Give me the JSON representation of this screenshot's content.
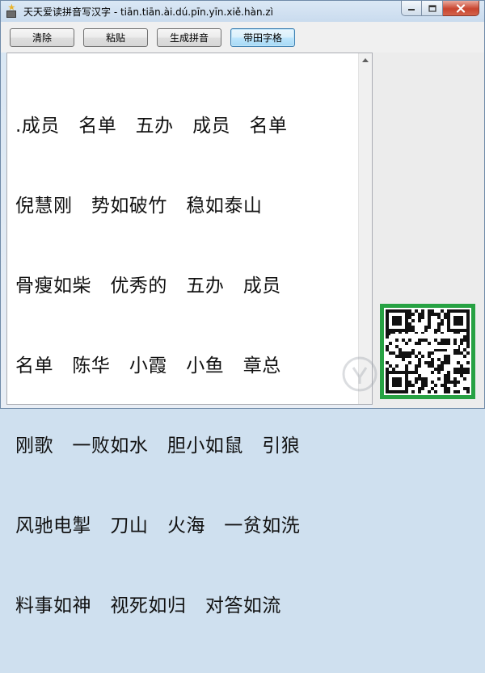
{
  "window": {
    "title": "天天爱读拼音写汉字 - tiān.tiān.ài.dú.pīn.yīn.xiě.hàn.zì"
  },
  "toolbar": {
    "buttons": [
      {
        "label": "清除"
      },
      {
        "label": "粘贴"
      },
      {
        "label": "生成拼音"
      },
      {
        "label": "带田字格"
      }
    ]
  },
  "editor": {
    "lines": [
      ".成员   名单   五办   成员   名单",
      "倪慧刚   势如破竹   稳如泰山",
      "骨瘦如柴   优秀的   五办   成员",
      "名单   陈华   小霞   小鱼   章总",
      "刚歌   一败如水   胆小如鼠   引狼",
      "风驰电掣   刀山   火海   一贫如洗",
      "料事如神   视死如归   对答如流"
    ]
  },
  "colors": {
    "qr_border": "#27a243",
    "active_button": "#3c7fb1"
  }
}
